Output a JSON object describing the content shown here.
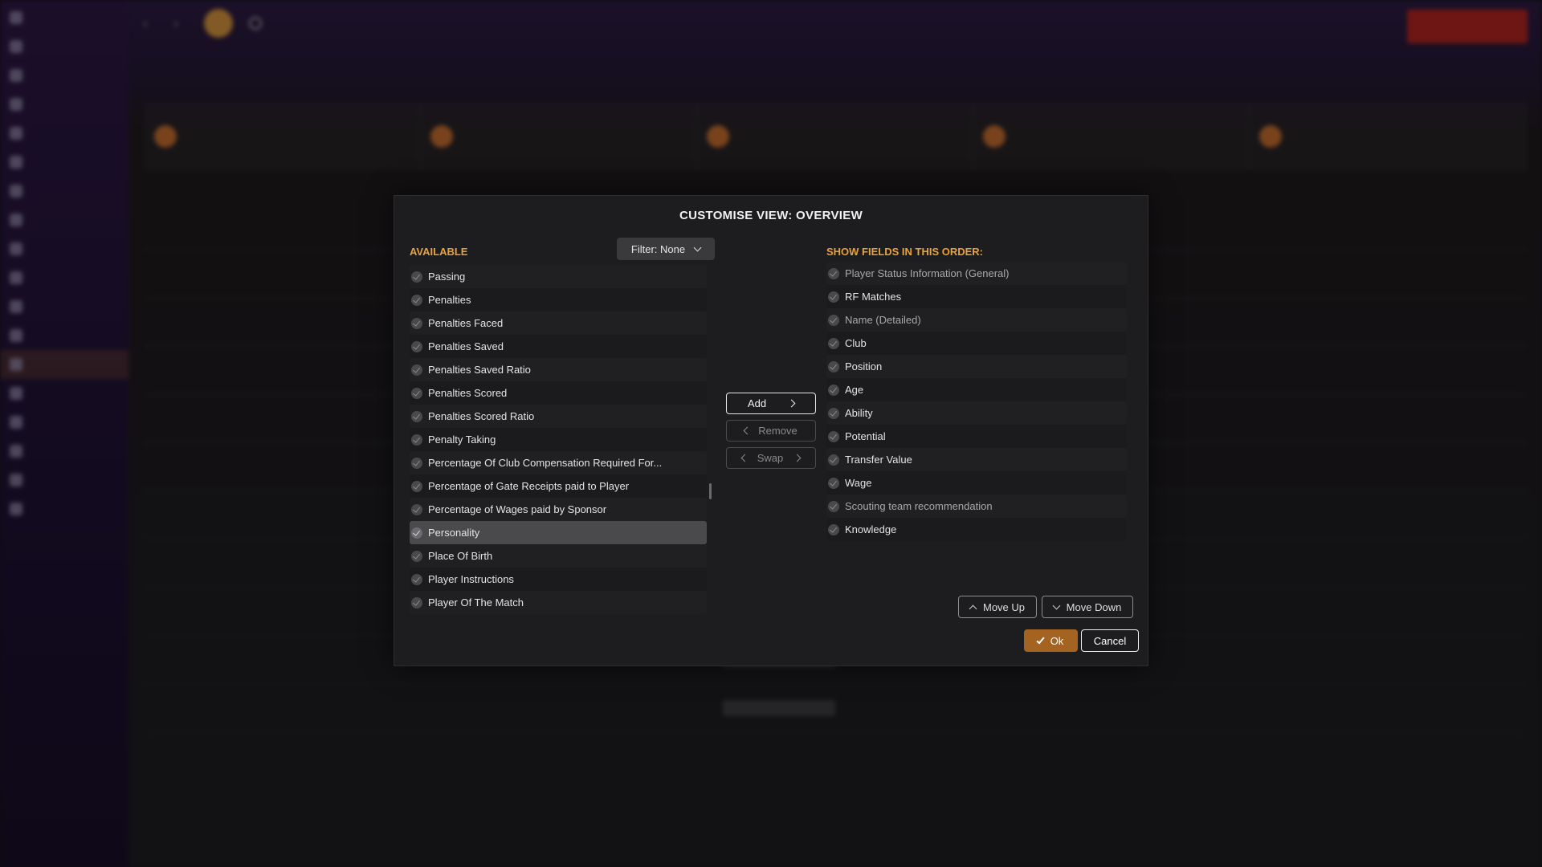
{
  "modal": {
    "title": "CUSTOMISE VIEW: OVERVIEW",
    "available_heading": "AVAILABLE",
    "filter_label": "Filter: None",
    "order_heading": "SHOW FIELDS IN THIS ORDER:",
    "available_fields": [
      {
        "label": "Passing"
      },
      {
        "label": "Penalties"
      },
      {
        "label": "Penalties Faced"
      },
      {
        "label": "Penalties Saved"
      },
      {
        "label": "Penalties Saved Ratio"
      },
      {
        "label": "Penalties Scored"
      },
      {
        "label": "Penalties Scored Ratio"
      },
      {
        "label": "Penalty Taking"
      },
      {
        "label": "Percentage Of Club Compensation Required For..."
      },
      {
        "label": "Percentage of Gate Receipts paid to Player"
      },
      {
        "label": "Percentage of Wages paid by Sponsor"
      },
      {
        "label": "Personality",
        "selected": true
      },
      {
        "label": "Place Of Birth"
      },
      {
        "label": "Player Instructions"
      },
      {
        "label": "Player Of The Match"
      }
    ],
    "shown_fields": [
      {
        "label": "Player Status Information (General)",
        "locked": true
      },
      {
        "label": "RF Matches"
      },
      {
        "label": "Name (Detailed)",
        "locked": true
      },
      {
        "label": "Club"
      },
      {
        "label": "Position"
      },
      {
        "label": "Age"
      },
      {
        "label": "Ability"
      },
      {
        "label": "Potential"
      },
      {
        "label": "Transfer Value"
      },
      {
        "label": "Wage"
      },
      {
        "label": "Scouting team recommendation",
        "locked": true
      },
      {
        "label": "Knowledge"
      }
    ],
    "buttons": {
      "add": "Add",
      "remove": "Remove",
      "swap": "Swap",
      "move_up": "Move Up",
      "move_down": "Move Down",
      "ok": "Ok",
      "cancel": "Cancel"
    }
  },
  "colors": {
    "accent": "#e8a23c",
    "ok_button": "#a46321",
    "modal_bg": "#1d1d1f",
    "selected_row": "#4a4a4d"
  },
  "icons": {
    "add": "chevron-right-icon",
    "remove": "chevron-left-icon",
    "swap": "swap-chevrons-icon",
    "move_up": "chevron-up-icon",
    "move_down": "chevron-down-icon",
    "ok": "check-icon",
    "filter": "chevron-down-icon",
    "field": "check-circle-icon"
  }
}
